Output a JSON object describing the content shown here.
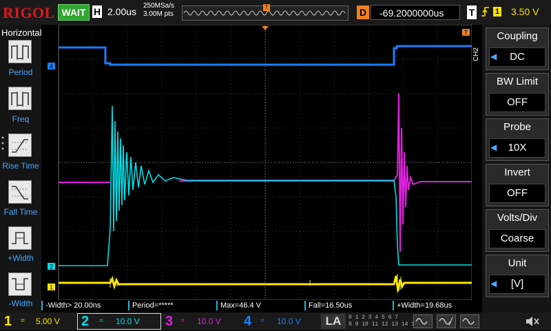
{
  "topbar": {
    "brand": "RIGOL",
    "run_state": "WAIT",
    "h_badge": "H",
    "timebase": "2.00us",
    "sample_rate": "250MSa/s",
    "mem_depth": "3.00M pts",
    "trigger_marker": "T",
    "d_badge": "D",
    "delay": "-69.2000000us",
    "t_badge": "T",
    "edge_icon": "rising-edge-icon",
    "trigger_source": "1",
    "trigger_level": "3.50 V"
  },
  "left_panel": {
    "title": "Horizontal",
    "items": [
      {
        "label": "Period",
        "icon": "period-icon"
      },
      {
        "label": "Freq",
        "icon": "frequency-icon"
      },
      {
        "label": "Rise Time",
        "icon": "rise-time-icon"
      },
      {
        "label": "Fall Time",
        "icon": "fall-time-icon"
      },
      {
        "label": "+Width",
        "icon": "positive-width-icon"
      },
      {
        "label": "-Width",
        "icon": "negative-width-icon"
      }
    ]
  },
  "screen": {
    "ch4_marker": "4",
    "ch2_marker": "2",
    "ch1_marker": "1",
    "trig_level_marker": "T",
    "right_trig_marker": "T",
    "colors": {
      "ch1": "#ffe600",
      "ch2": "#00e0e8",
      "ch3": "#e020e0",
      "ch4": "#1a7fff",
      "grid": "#555555"
    }
  },
  "right_panel": {
    "channel_tab": "CH2",
    "items": [
      {
        "title": "Coupling",
        "value": "DC"
      },
      {
        "title": "BW Limit",
        "value": "OFF"
      },
      {
        "title": "Probe",
        "value": "10X"
      },
      {
        "title": "Invert",
        "value": "OFF"
      },
      {
        "title": "Volts/Div",
        "value": "Coarse"
      },
      {
        "title": "Unit",
        "value": "[V]"
      }
    ]
  },
  "measurements": [
    "-Width> 20.00ns",
    "Period=*****",
    "Max=46.4 V",
    "Fall=16.50us",
    "+Width=19.68us"
  ],
  "bottombar": {
    "ch1": {
      "num": "1",
      "coupling": "=",
      "scale": "5.00 V"
    },
    "ch2": {
      "num": "2",
      "coupling": "=",
      "scale": "10.0 V"
    },
    "ch3": {
      "num": "3",
      "coupling": "=",
      "scale": "10.0 V"
    },
    "ch4": {
      "num": "4",
      "coupling": "=",
      "scale": "10.0 V"
    },
    "la": "LA",
    "la_digits_row1": "0 1 2 3  4 5 6 7",
    "la_digits_row2": "8 9 10 11  12 13 14 15",
    "speaker_icon": "speaker-muted-icon"
  }
}
